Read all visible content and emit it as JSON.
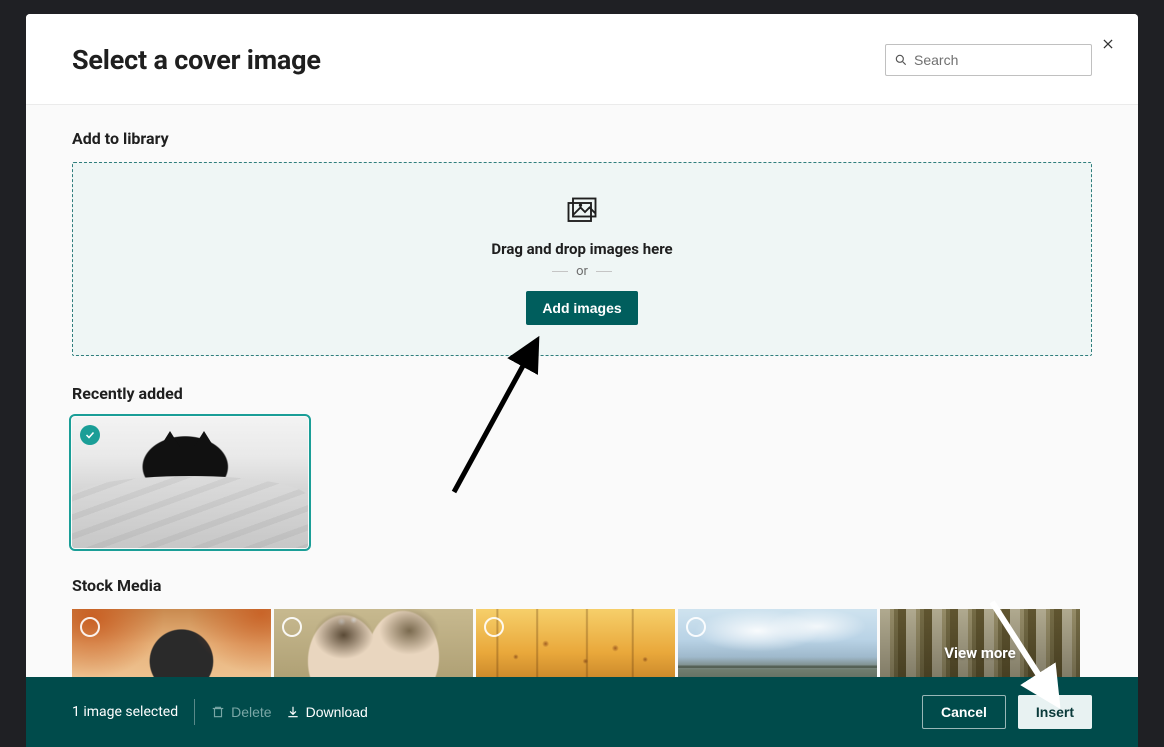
{
  "modal": {
    "title": "Select a cover image",
    "search_placeholder": "Search"
  },
  "sections": {
    "add_to_library": "Add to library",
    "recently_added": "Recently added",
    "stock_media": "Stock Media"
  },
  "dropzone": {
    "drag_text": "Drag and drop images here",
    "or_text": "or",
    "add_images_label": "Add images"
  },
  "stock": {
    "view_more_label": "View more"
  },
  "footer": {
    "selected_text": "1 image selected",
    "delete_label": "Delete",
    "download_label": "Download",
    "cancel_label": "Cancel",
    "insert_label": "Insert"
  }
}
